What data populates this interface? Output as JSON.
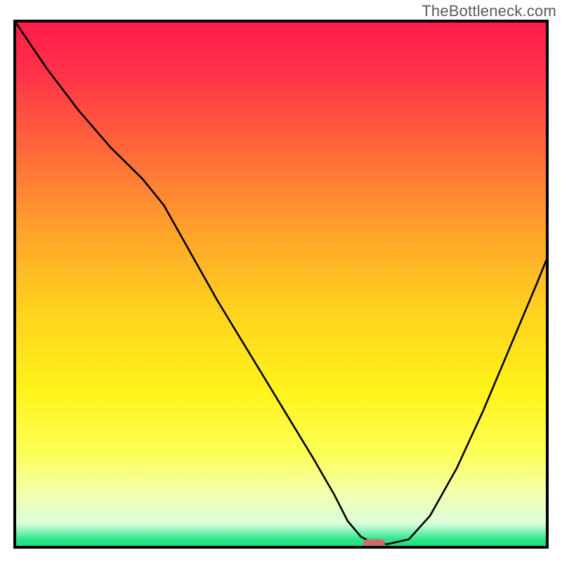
{
  "watermark": "TheBottleneck.com",
  "chart_data": {
    "type": "line",
    "title": "",
    "xlabel": "",
    "ylabel": "",
    "xlim": [
      0,
      100
    ],
    "ylim": [
      0,
      100
    ],
    "grid": false,
    "legend": false,
    "axes_visible": false,
    "background_gradient_stops": [
      {
        "offset": 0.0,
        "color": "#ff1a4b"
      },
      {
        "offset": 0.1,
        "color": "#ff3249"
      },
      {
        "offset": 0.25,
        "color": "#ff6a3a"
      },
      {
        "offset": 0.4,
        "color": "#ffa32c"
      },
      {
        "offset": 0.55,
        "color": "#ffd21f"
      },
      {
        "offset": 0.7,
        "color": "#fff31a"
      },
      {
        "offset": 0.82,
        "color": "#fdff56"
      },
      {
        "offset": 0.9,
        "color": "#f4ffb0"
      },
      {
        "offset": 0.955,
        "color": "#d9ffdc"
      },
      {
        "offset": 0.985,
        "color": "#2ee68b"
      },
      {
        "offset": 1.0,
        "color": "#18df81"
      }
    ],
    "series": [
      {
        "name": "bottleneck-curve",
        "x": [
          0,
          6,
          12,
          18,
          24,
          28,
          33,
          38,
          44,
          50,
          56,
          60,
          62.5,
          65,
          67.5,
          70,
          74,
          78,
          83,
          88,
          93,
          98,
          100
        ],
        "y": [
          100,
          91,
          83,
          76,
          70,
          65,
          56,
          47,
          37,
          27,
          17,
          10,
          5,
          2,
          0.7,
          0.6,
          1.5,
          6,
          15,
          26,
          38,
          50,
          55
        ]
      }
    ],
    "marker": {
      "name": "optimum-marker",
      "x": 67.5,
      "y": 0.8,
      "width_pct": 4.2,
      "height_pct": 1.4,
      "color": "#d26a6a"
    },
    "plot_border_color": "#000000",
    "curve_color": "#000000"
  }
}
